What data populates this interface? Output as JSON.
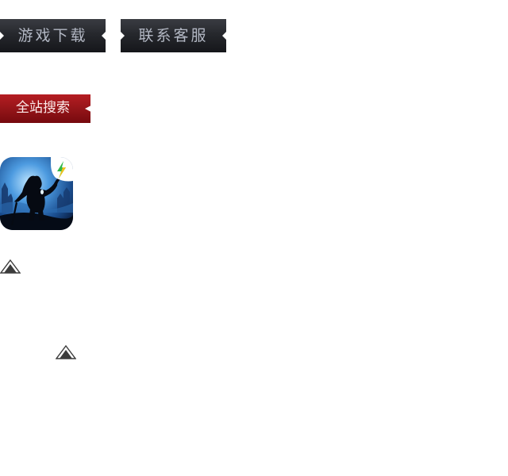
{
  "nav": {
    "download_label": "游戏下载",
    "contact_label": "联系客服"
  },
  "search": {
    "label": "全站搜索"
  },
  "app_icon": {
    "icon": "game-app-icon"
  },
  "scroll": {
    "icon": "triangle-up-icon"
  },
  "colors": {
    "dark_button": "#222429",
    "dark_button_text": "#b3b8c4",
    "search_red": "#9b161b",
    "arrow": "#3c3c3c"
  }
}
